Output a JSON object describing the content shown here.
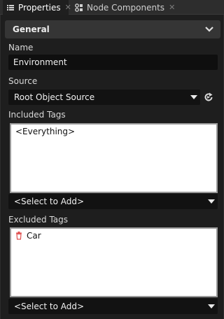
{
  "tabs": [
    {
      "label": "Properties",
      "icon": "list-icon",
      "active": true
    },
    {
      "label": "Node Components",
      "icon": "node-components-icon",
      "active": false
    }
  ],
  "section": {
    "title": "General"
  },
  "name": {
    "label": "Name",
    "value": "Environment"
  },
  "source": {
    "label": "Source",
    "value": "Root Object Source"
  },
  "included_tags": {
    "label": "Included Tags",
    "items": [
      "<Everything>"
    ],
    "add_label": "<Select to Add>"
  },
  "excluded_tags": {
    "label": "Excluded Tags",
    "items": [
      {
        "label": "Car",
        "icon": "trash-icon"
      }
    ],
    "add_label": "<Select to Add>"
  },
  "colors": {
    "accent_delete": "#e05050",
    "panel_bg": "#1e1e1e",
    "field_bg": "#0f0f0f"
  }
}
